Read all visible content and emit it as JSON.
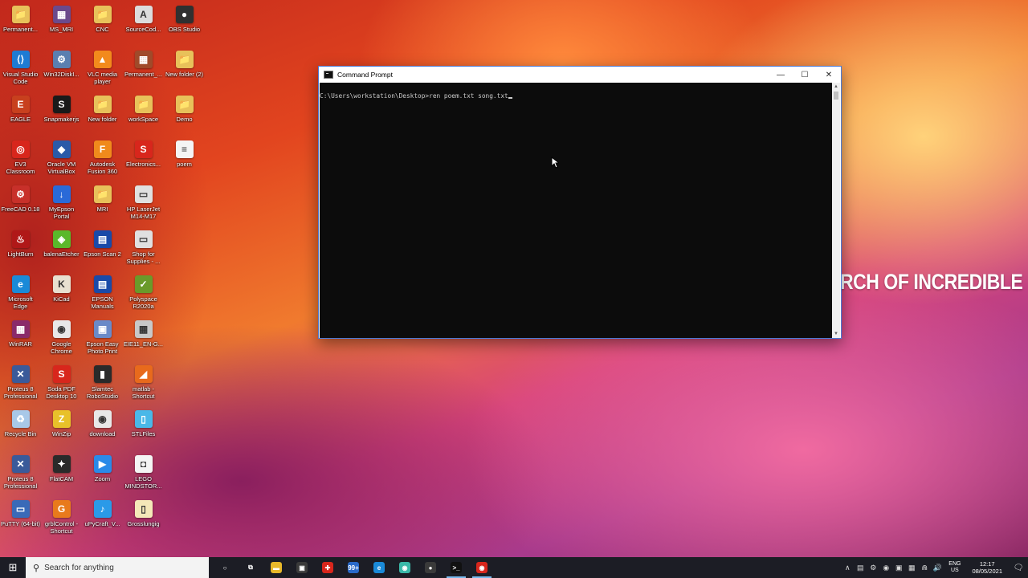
{
  "desktop": {
    "icons": [
      {
        "label": "Permanent...",
        "color": "#e8c15a",
        "glyph": "📁"
      },
      {
        "label": "MS_MRI",
        "color": "#6b4a8c",
        "glyph": "▦"
      },
      {
        "label": "CNC",
        "color": "#e8c15a",
        "glyph": "📁"
      },
      {
        "label": "SourceCod...",
        "color": "#dcdcdc",
        "glyph": "A"
      },
      {
        "label": "OBS Studio",
        "color": "#303030",
        "glyph": "●"
      },
      {
        "label": "Visual Studio Code",
        "color": "#1e7bd4",
        "glyph": "⟨⟩"
      },
      {
        "label": "Win32DiskI...",
        "color": "#5a7fb0",
        "glyph": "⚙"
      },
      {
        "label": "VLC media player",
        "color": "#f28a1c",
        "glyph": "▲"
      },
      {
        "label": "Permanent_...",
        "color": "#a04a2a",
        "glyph": "▦"
      },
      {
        "label": "New folder (2)",
        "color": "#e8c15a",
        "glyph": "📁"
      },
      {
        "label": "EAGLE",
        "color": "#c8401e",
        "glyph": "E"
      },
      {
        "label": "Snapmakerjs",
        "color": "#1a1a1a",
        "glyph": "S"
      },
      {
        "label": "New folder",
        "color": "#e8c15a",
        "glyph": "📁"
      },
      {
        "label": "workSpace",
        "color": "#e8c15a",
        "glyph": "📁"
      },
      {
        "label": "Demo",
        "color": "#e8c15a",
        "glyph": "📁"
      },
      {
        "label": "EV3 Classroom",
        "color": "#d8261c",
        "glyph": "◎"
      },
      {
        "label": "Oracle VM VirtualBox",
        "color": "#2a5aa8",
        "glyph": "◆"
      },
      {
        "label": "Autodesk Fusion 360",
        "color": "#f08a1c",
        "glyph": "F"
      },
      {
        "label": "Electronics...",
        "color": "#d8261c",
        "glyph": "S"
      },
      {
        "label": "poem",
        "color": "#f4f4f4",
        "glyph": "≡"
      },
      {
        "label": "FreeCAD 0.18",
        "color": "#c8302a",
        "glyph": "⚙"
      },
      {
        "label": "MyEpson Portal",
        "color": "#2a6ad8",
        "glyph": "↓"
      },
      {
        "label": "MRI",
        "color": "#e8c15a",
        "glyph": "📁"
      },
      {
        "label": "HP LaserJet M14-M17",
        "color": "#e0e0e0",
        "glyph": "▭"
      },
      {
        "label": "",
        "color": "",
        "glyph": ""
      },
      {
        "label": "LightBurn",
        "color": "#b01818",
        "glyph": "♨"
      },
      {
        "label": "balenaEtcher",
        "color": "#5ab82a",
        "glyph": "◈"
      },
      {
        "label": "Epson Scan 2",
        "color": "#1a4aa8",
        "glyph": "▤"
      },
      {
        "label": "Shop for Supplies - ...",
        "color": "#e0e0e0",
        "glyph": "▭"
      },
      {
        "label": "",
        "color": "",
        "glyph": ""
      },
      {
        "label": "Microsoft Edge",
        "color": "#1a8ad8",
        "glyph": "e"
      },
      {
        "label": "KiCad",
        "color": "#e8e0d0",
        "glyph": "K"
      },
      {
        "label": "EPSON Manuals",
        "color": "#1a4aa8",
        "glyph": "▤"
      },
      {
        "label": "Polyspace R2020a",
        "color": "#6a9a2a",
        "glyph": "✓"
      },
      {
        "label": "",
        "color": "",
        "glyph": ""
      },
      {
        "label": "WinRAR",
        "color": "#8a2a6a",
        "glyph": "▦"
      },
      {
        "label": "Google Chrome",
        "color": "#e8e8e8",
        "glyph": "◉"
      },
      {
        "label": "Epson Easy Photo Print",
        "color": "#6a8ac8",
        "glyph": "▣"
      },
      {
        "label": "EIE11_EN-G...",
        "color": "#c8c8c8",
        "glyph": "▦"
      },
      {
        "label": "",
        "color": "",
        "glyph": ""
      },
      {
        "label": "Proteus 8 Professional",
        "color": "#3a5a9a",
        "glyph": "✕"
      },
      {
        "label": "Soda PDF Desktop 10",
        "color": "#d8261c",
        "glyph": "S"
      },
      {
        "label": "Slamtec RoboStudio",
        "color": "#2a2a2a",
        "glyph": "▮"
      },
      {
        "label": "matlab - Shortcut",
        "color": "#e86a1c",
        "glyph": "◢"
      },
      {
        "label": "",
        "color": "",
        "glyph": ""
      },
      {
        "label": "Recycle Bin",
        "color": "#a8c8e8",
        "glyph": "♻"
      },
      {
        "label": "WinZip",
        "color": "#e8c12a",
        "glyph": "Z"
      },
      {
        "label": "download",
        "color": "#e8e8e8",
        "glyph": "◉"
      },
      {
        "label": "STLFiles",
        "color": "#4ab8e8",
        "glyph": "▯"
      },
      {
        "label": "",
        "color": "",
        "glyph": ""
      },
      {
        "label": "Proteus 8 Professional",
        "color": "#3a5a9a",
        "glyph": "✕"
      },
      {
        "label": "FlatCAM",
        "color": "#2a2a2a",
        "glyph": "✦"
      },
      {
        "label": "Zoom",
        "color": "#2a8ae8",
        "glyph": "▶"
      },
      {
        "label": "LEGO MINDSTOR...",
        "color": "#f4f4f4",
        "glyph": "◘"
      },
      {
        "label": "",
        "color": "",
        "glyph": ""
      },
      {
        "label": "PuTTY (64-bit)",
        "color": "#3a6ab8",
        "glyph": "▭"
      },
      {
        "label": "grblControl - Shortcut",
        "color": "#e87a1c",
        "glyph": "G"
      },
      {
        "label": "uPyCraft_V...",
        "color": "#2a9ae8",
        "glyph": "♪"
      },
      {
        "label": "Grosslungig",
        "color": "#f4e8b8",
        "glyph": "▯"
      },
      {
        "label": "",
        "color": "",
        "glyph": ""
      }
    ],
    "overlay_text": "RCH OF INCREDIBLE"
  },
  "cmd": {
    "title": "Command Prompt",
    "prompt": "C:\\Users\\workstation\\Desktop>ren poem.txt song.txt",
    "min_glyph": "—",
    "max_glyph": "☐",
    "close_glyph": "✕"
  },
  "taskbar": {
    "start_glyph": "⊞",
    "search_placeholder": "Search for anything",
    "search_glyph": "⚲",
    "apps": [
      {
        "name": "cortana",
        "glyph": "○",
        "color": "",
        "active": false
      },
      {
        "name": "task-view",
        "glyph": "⧉",
        "color": "",
        "active": false
      },
      {
        "name": "file-explorer",
        "glyph": "▬",
        "color": "#e8b82a",
        "active": false
      },
      {
        "name": "store",
        "glyph": "▣",
        "color": "#3a3a3a",
        "active": false
      },
      {
        "name": "gift",
        "glyph": "✚",
        "color": "#d8261c",
        "active": false
      },
      {
        "name": "mail-99",
        "glyph": "99+",
        "color": "#2a6ac8",
        "active": false
      },
      {
        "name": "edge",
        "glyph": "e",
        "color": "#1a8ad8",
        "active": false
      },
      {
        "name": "browser-green",
        "glyph": "◉",
        "color": "#3ab8a8",
        "active": false
      },
      {
        "name": "obs",
        "glyph": "●",
        "color": "#3a3a3a",
        "active": false
      },
      {
        "name": "command-prompt",
        "glyph": ">_",
        "color": "#111111",
        "active": true
      },
      {
        "name": "chrome",
        "glyph": "◉",
        "color": "#d8261c",
        "active": true
      }
    ],
    "tray": {
      "overflow_glyph": "∧",
      "icons": [
        "▤",
        "⚙",
        "◉",
        "▣",
        "▦",
        "⋒",
        "🔊"
      ],
      "lang_top": "ENG",
      "lang_bottom": "US",
      "time": "12:17",
      "date": "08/05/2021",
      "notif_glyph": "🗨"
    }
  }
}
